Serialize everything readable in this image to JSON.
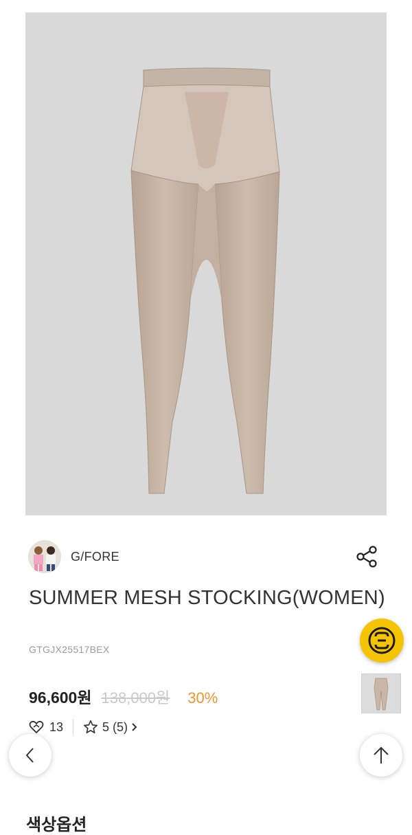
{
  "product": {
    "image_alt": "mesh leggings product photo",
    "brand": "G/FORE",
    "title": "SUMMER MESH STOCKING(WOMEN)",
    "sku": "GTGJX25517BEX",
    "price": "96,600원",
    "original_price": "138,000원",
    "discount": "30%",
    "likes": "13",
    "rating": "5 (5)"
  },
  "icons": {
    "share": "share-icon",
    "heart": "heart-icon",
    "star": "star-icon",
    "chevron_right": "chevron-right-icon",
    "back": "chevron-left-icon",
    "scroll_top": "arrow-up-icon",
    "brand_badge": "gfore-logo-icon"
  },
  "sections": {
    "next_title": "색상옵션"
  },
  "colors": {
    "discount": "#f0952e",
    "badge": "#f5c400",
    "hero_bg": "#d9d9d9"
  }
}
